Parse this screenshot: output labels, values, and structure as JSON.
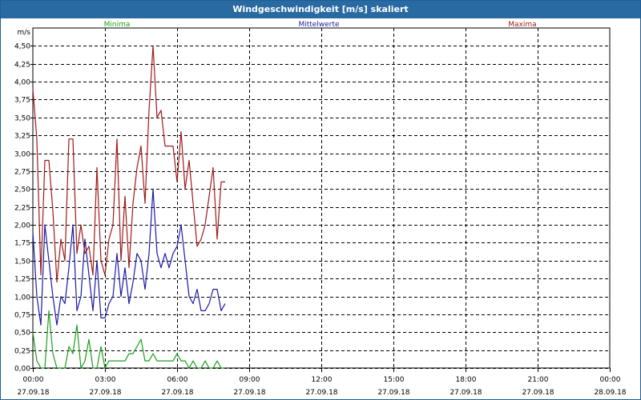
{
  "window": {
    "title": "Windgeschwindigkeit [m/s] skaliert"
  },
  "colors": {
    "min": "#1aa01a",
    "mean": "#1a1aa8",
    "max": "#a01a1a",
    "grid": "#000000"
  },
  "chart_data": {
    "type": "line",
    "title": "Windgeschwindigkeit [m/s] skaliert",
    "ylabel": "m/s",
    "ylim": [
      0,
      4.75
    ],
    "xlim": [
      "27.09.18 00:00",
      "28.09.18 00:00"
    ],
    "grid": true,
    "legend": "top",
    "y_ticks": [
      "0,00",
      "0,25",
      "0,50",
      "0,75",
      "1,00",
      "1,25",
      "1,50",
      "1,75",
      "2,00",
      "2,25",
      "2,50",
      "2,75",
      "3,00",
      "3,25",
      "3,50",
      "3,75",
      "4,00",
      "4,25",
      "4,50"
    ],
    "x_ticks": [
      {
        "time": "00:00",
        "date": "27.09.18"
      },
      {
        "time": "03:00",
        "date": "27.09.18"
      },
      {
        "time": "06:00",
        "date": "27.09.18"
      },
      {
        "time": "09:00",
        "date": "27.09.18"
      },
      {
        "time": "12:00",
        "date": "27.09.18"
      },
      {
        "time": "15:00",
        "date": "27.09.18"
      },
      {
        "time": "18:00",
        "date": "27.09.18"
      },
      {
        "time": "21:00",
        "date": "27.09.18"
      },
      {
        "time": "00:00",
        "date": "28.09.18"
      }
    ],
    "x": [
      "00:00",
      "00:10",
      "00:20",
      "00:30",
      "00:40",
      "00:50",
      "01:00",
      "01:10",
      "01:20",
      "01:30",
      "01:40",
      "01:50",
      "02:00",
      "02:10",
      "02:20",
      "02:30",
      "02:40",
      "02:50",
      "03:00",
      "03:10",
      "03:20",
      "03:30",
      "03:40",
      "03:50",
      "04:00",
      "04:10",
      "04:20",
      "04:30",
      "04:40",
      "04:50",
      "05:00",
      "05:10",
      "05:20",
      "05:30",
      "05:40",
      "05:50",
      "06:00",
      "06:10",
      "06:20",
      "06:30",
      "06:40",
      "06:50",
      "07:00",
      "07:10",
      "07:20",
      "07:30",
      "07:40",
      "07:50",
      "08:00"
    ],
    "series": [
      {
        "name": "Minima",
        "color": "#1aa01a",
        "values": [
          0.5,
          0.1,
          0.0,
          0.0,
          0.8,
          0.2,
          0.0,
          0.0,
          0.0,
          0.3,
          0.2,
          0.6,
          0.0,
          0.1,
          0.4,
          0.0,
          0.0,
          0.3,
          0.0,
          0.1,
          0.1,
          0.1,
          0.1,
          0.1,
          0.2,
          0.2,
          0.3,
          0.4,
          0.1,
          0.1,
          0.2,
          0.1,
          0.1,
          0.1,
          0.1,
          0.1,
          0.2,
          0.1,
          0.1,
          0.0,
          0.1,
          0.0,
          0.0,
          0.1,
          0.0,
          0.0,
          0.1,
          0.0,
          0.0
        ]
      },
      {
        "name": "Mittelwerte",
        "color": "#1a1aa8",
        "values": [
          1.9,
          1.0,
          0.6,
          2.0,
          1.5,
          1.0,
          0.6,
          1.0,
          0.9,
          1.4,
          2.0,
          0.8,
          1.0,
          1.8,
          1.3,
          0.8,
          1.5,
          0.7,
          0.7,
          0.9,
          1.0,
          1.6,
          1.0,
          1.4,
          0.9,
          1.2,
          1.6,
          1.5,
          1.1,
          1.6,
          2.5,
          1.6,
          1.4,
          1.6,
          1.4,
          1.6,
          1.7,
          2.0,
          1.5,
          1.0,
          0.9,
          1.1,
          0.8,
          0.8,
          0.9,
          1.1,
          1.1,
          0.8,
          0.9
        ]
      },
      {
        "name": "Maxima",
        "color": "#a01a1a",
        "values": [
          3.9,
          3.2,
          1.3,
          2.9,
          2.9,
          2.2,
          1.2,
          1.8,
          1.5,
          3.2,
          3.2,
          1.6,
          2.0,
          1.6,
          1.7,
          1.3,
          2.8,
          1.5,
          1.3,
          1.8,
          2.0,
          3.2,
          1.5,
          2.4,
          1.4,
          2.3,
          2.8,
          3.1,
          2.3,
          3.6,
          4.5,
          3.5,
          3.6,
          3.1,
          3.1,
          3.1,
          2.6,
          3.3,
          2.5,
          2.9,
          2.3,
          1.7,
          1.8,
          2.0,
          2.4,
          2.8,
          1.8,
          2.6,
          2.6
        ]
      }
    ]
  }
}
